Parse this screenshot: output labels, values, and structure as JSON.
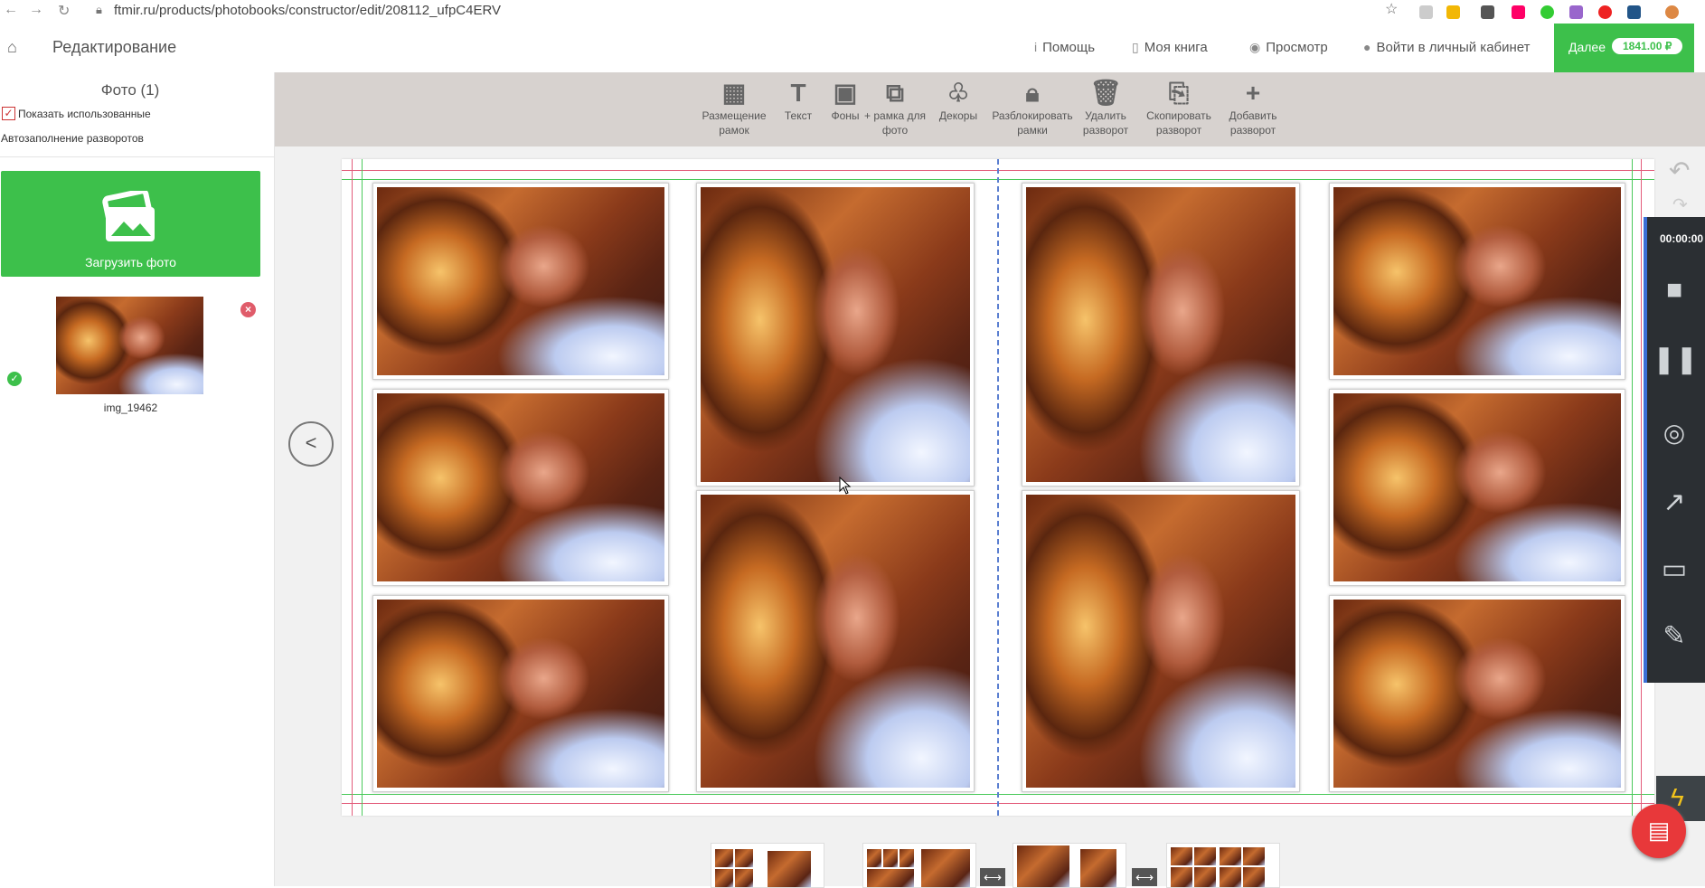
{
  "browser": {
    "url": "ftmir.ru/products/photobooks/constructor/edit/208112_ufpC4ERV",
    "back_icon": "arrow-left-icon",
    "forward_icon": "arrow-right-icon",
    "reload_icon": "reload-icon",
    "bookmark_icon": "star-icon"
  },
  "header": {
    "home_icon": "home-icon",
    "title": "Редактирование",
    "nav": [
      {
        "label": "Помощь",
        "icon": "info-icon"
      },
      {
        "label": "Моя книга",
        "icon": "book-icon"
      },
      {
        "label": "Просмотр",
        "icon": "eye-icon"
      },
      {
        "label": "Войти в личный кабинет",
        "icon": "user-icon"
      }
    ],
    "next_label": "Далее",
    "price": "1841.00 ₽"
  },
  "sidebar": {
    "photos_title": "Фото (1)",
    "show_used_label": "Показать использованные",
    "show_used_checked": true,
    "autofill_label": "Автозаполнение разворотов",
    "upload_label": "Загрузить фото",
    "photo_name": "img_19462"
  },
  "toolbar": {
    "tools": [
      {
        "label": "Размещение рамок",
        "icon": "grid-icon"
      },
      {
        "label": "Текст",
        "icon": "text-icon"
      },
      {
        "label": "Фоны",
        "icon": "image-icon"
      },
      {
        "label": "+ рамка для фото",
        "icon": "add-frame-icon"
      },
      {
        "label": "Декоры",
        "icon": "balloons-icon"
      },
      {
        "label": "Разблокировать рамки",
        "icon": "lock-icon"
      },
      {
        "label": "Удалить разворот",
        "icon": "trash-icon"
      },
      {
        "label": "Скопировать разворот",
        "icon": "copy-icon"
      },
      {
        "label": "Добавить разворот",
        "icon": "plus-icon"
      }
    ]
  },
  "recorder": {
    "time": "00:00:00"
  },
  "colors": {
    "accent_green": "#3dc04b",
    "toolbar_bg": "#d7d2cf",
    "recorder_bg": "#2b2f33",
    "chat_red": "#e8383a"
  }
}
